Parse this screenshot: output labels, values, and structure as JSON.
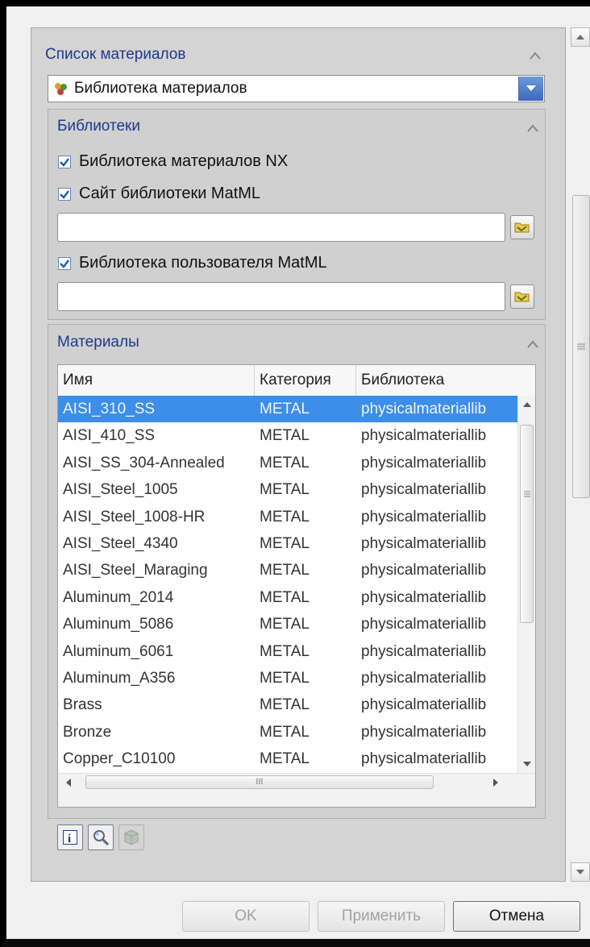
{
  "material_list": {
    "title": "Список материалов",
    "combo_value": "Библиотека материалов"
  },
  "libraries": {
    "title": "Библиотеки",
    "nx_library": {
      "label": "Библиотека материалов NX",
      "checked": true
    },
    "matml_site": {
      "label": "Сайт библиотеки MatML",
      "checked": true,
      "value": ""
    },
    "matml_user": {
      "label": "Библиотека пользователя MatML",
      "checked": true,
      "value": ""
    }
  },
  "materials": {
    "title": "Материалы",
    "columns": [
      "Имя",
      "Категория",
      "Библиотека"
    ],
    "rows": [
      {
        "name": "AISI_310_SS",
        "category": "METAL",
        "library": "physicalmateriallib",
        "selected": true
      },
      {
        "name": "AISI_410_SS",
        "category": "METAL",
        "library": "physicalmateriallib"
      },
      {
        "name": "AISI_SS_304-Annealed",
        "category": "METAL",
        "library": "physicalmateriallib"
      },
      {
        "name": "AISI_Steel_1005",
        "category": "METAL",
        "library": "physicalmateriallib"
      },
      {
        "name": "AISI_Steel_1008-HR",
        "category": "METAL",
        "library": "physicalmateriallib"
      },
      {
        "name": "AISI_Steel_4340",
        "category": "METAL",
        "library": "physicalmateriallib"
      },
      {
        "name": "AISI_Steel_Maraging",
        "category": "METAL",
        "library": "physicalmateriallib"
      },
      {
        "name": "Aluminum_2014",
        "category": "METAL",
        "library": "physicalmateriallib"
      },
      {
        "name": "Aluminum_5086",
        "category": "METAL",
        "library": "physicalmateriallib"
      },
      {
        "name": "Aluminum_6061",
        "category": "METAL",
        "library": "physicalmateriallib"
      },
      {
        "name": "Aluminum_A356",
        "category": "METAL",
        "library": "physicalmateriallib"
      },
      {
        "name": "Brass",
        "category": "METAL",
        "library": "physicalmateriallib"
      },
      {
        "name": "Bronze",
        "category": "METAL",
        "library": "physicalmateriallib"
      },
      {
        "name": "Copper_C10100",
        "category": "METAL",
        "library": "physicalmateriallib"
      }
    ],
    "hscroll_grip": "III"
  },
  "buttons": {
    "ok": "OK",
    "apply": "Применить",
    "cancel": "Отмена"
  },
  "colors": {
    "section_title": "#1f3a8a",
    "selection": "#3d8ee8"
  }
}
